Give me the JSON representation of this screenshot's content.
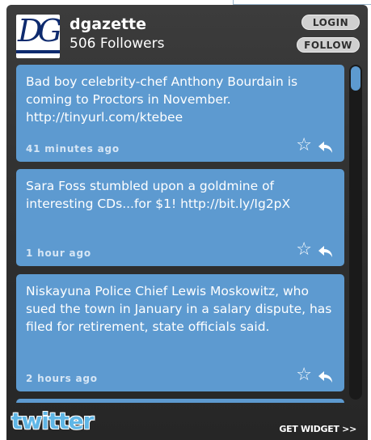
{
  "header": {
    "logo_text": "DG",
    "username": "dgazette",
    "followers": "506 Followers",
    "login_label": "LOGIN",
    "follow_label": "FOLLOW"
  },
  "tweets": [
    {
      "text": "Bad boy celebrity-chef Anthony Bourdain is coming to Proctors in November. http://tinyurl.com/ktebee",
      "time": "41 minutes ago"
    },
    {
      "text": "Sara Foss stumbled upon a goldmine of interesting CDs...for $1! http://bit.ly/Ig2pX",
      "time": "1 hour ago"
    },
    {
      "text": "Niskayuna Police Chief Lewis Moskowitz, who sued the town in January in a salary dispute, has filed for retirement, state officials said.",
      "time": "2 hours ago"
    }
  ],
  "footer": {
    "brand": "twitter",
    "get_widget": "GET WIDGET >>"
  },
  "colors": {
    "tweet_bg": "#5d9ad0",
    "widget_bg": "#303030",
    "brand": "#5fb6e6"
  }
}
